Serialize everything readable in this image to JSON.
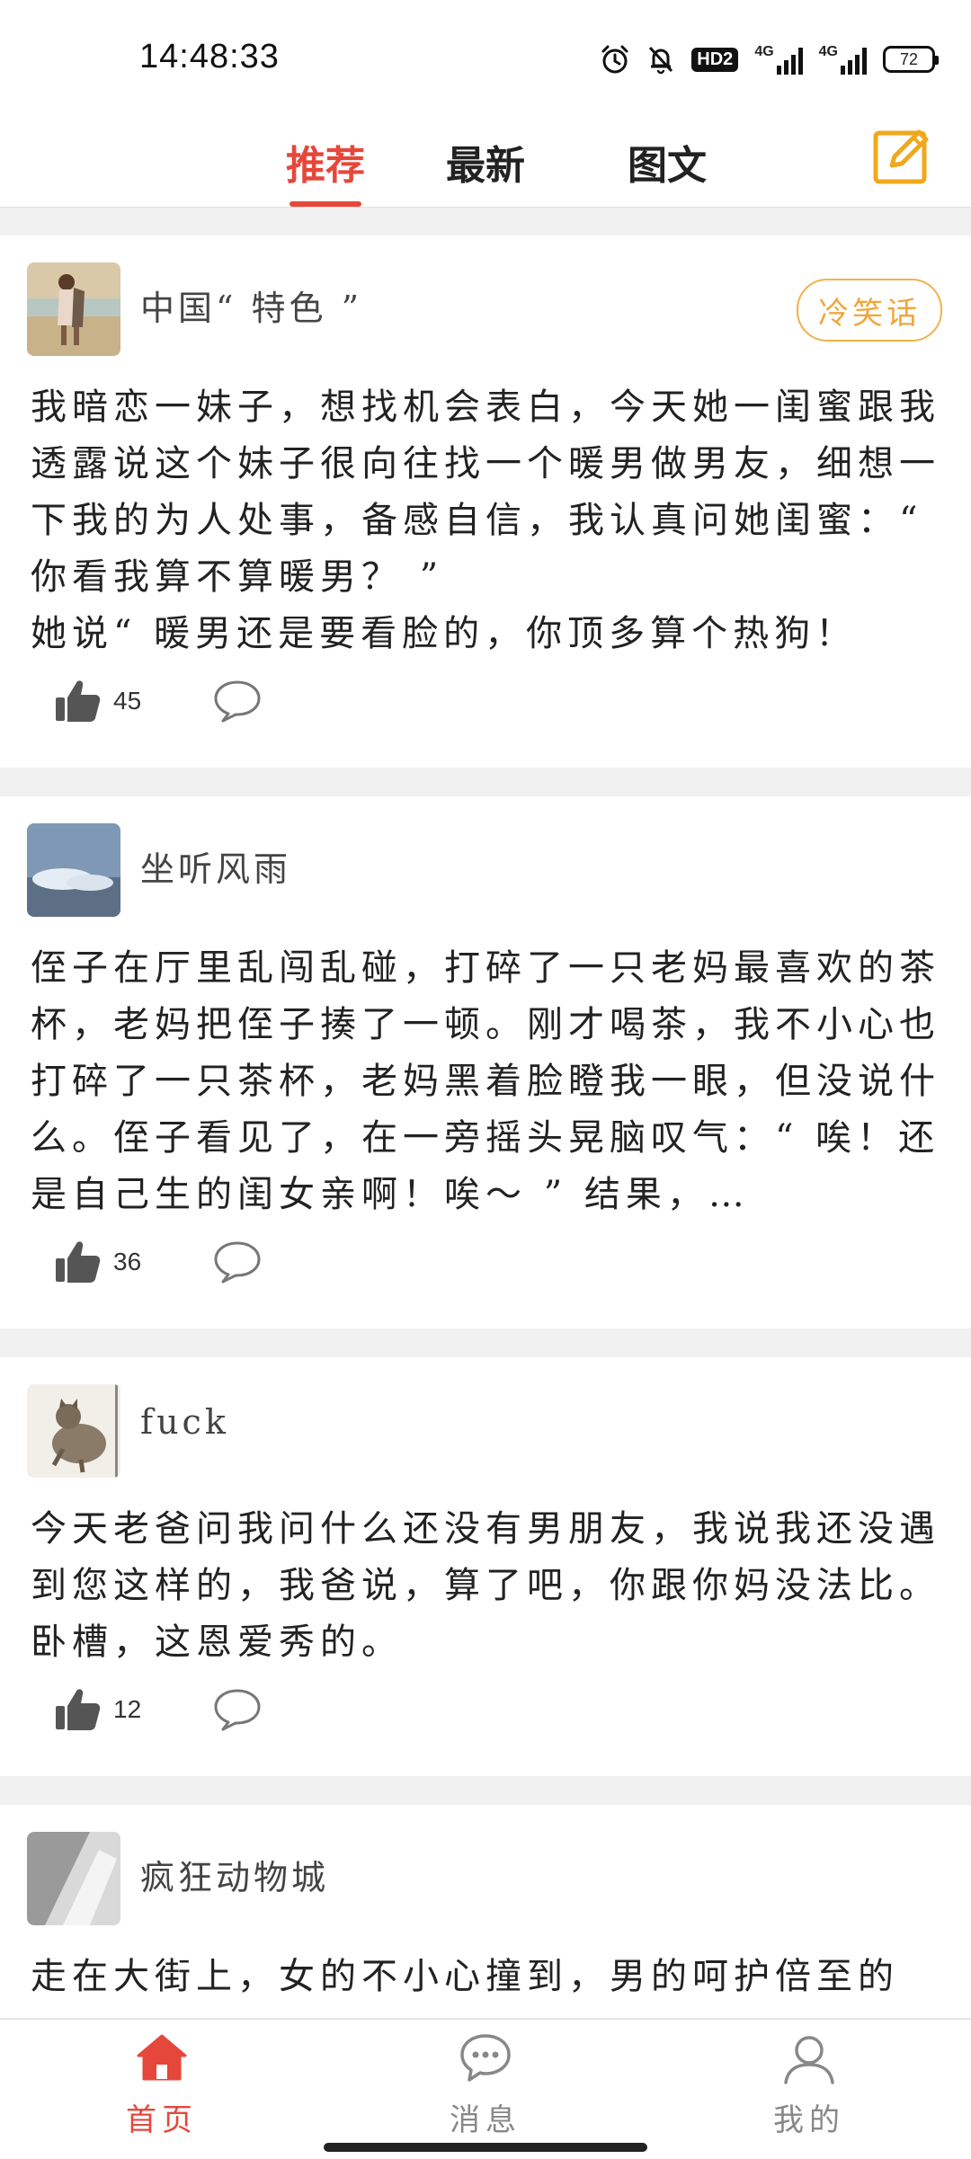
{
  "status_bar": {
    "time": "14:48:33",
    "icons": [
      "alarm-icon",
      "bell-mute-icon",
      "hd-icon",
      "signal-4g-icon",
      "signal-4g-icon",
      "battery-icon"
    ],
    "hd_label": "HD2",
    "net1_label": "4G",
    "net2_label": "4G",
    "battery_level": "72"
  },
  "top_tabs": {
    "items": [
      {
        "label": "推荐",
        "active": true
      },
      {
        "label": "最新",
        "active": false
      },
      {
        "label": "图文",
        "active": false
      }
    ],
    "compose_icon": "edit-icon",
    "accent_color": "#e6473b"
  },
  "feed": [
    {
      "username": "中国“ 特色 ”",
      "tag": "冷笑话",
      "content": "我暗恋一妹子，想找机会表白，今天她一闺蜜跟我透露说这个妹子很向往找一个暖男做男友，细想一下我的为人处事，备感自信，我认真问她闺蜜：“ 你看我算不算暖男？ ”\n她说“ 暖男还是要看脸的，你顶多算个热狗！",
      "likes": "45"
    },
    {
      "username": "坐听风雨",
      "content": "侄子在厅里乱闯乱碰，打碎了一只老妈最喜欢的茶杯，老妈把侄子揍了一顿。刚才喝茶，我不小心也打碎了一只茶杯，老妈黑着脸瞪我一眼，但没说什么。侄子看见了，在一旁摇头晃脑叹气：“ 唉！还是自己生的闺女亲啊！唉～ ” 结果，…",
      "likes": "36"
    },
    {
      "username": "fuck",
      "content": "今天老爸问我问什么还没有男朋友，我说我还没遇到您这样的，我爸说，算了吧，你跟你妈没法比。卧槽，这恩爱秀的。",
      "likes": "12"
    },
    {
      "username": "疯狂动物城",
      "content": "走在大街上，女的不小心撞到，男的呵护倍至的"
    }
  ],
  "bottom_nav": {
    "items": [
      {
        "label": "首页",
        "icon": "home-icon",
        "active": true
      },
      {
        "label": "消息",
        "icon": "message-icon",
        "active": false
      },
      {
        "label": "我的",
        "icon": "profile-icon",
        "active": false
      }
    ]
  }
}
